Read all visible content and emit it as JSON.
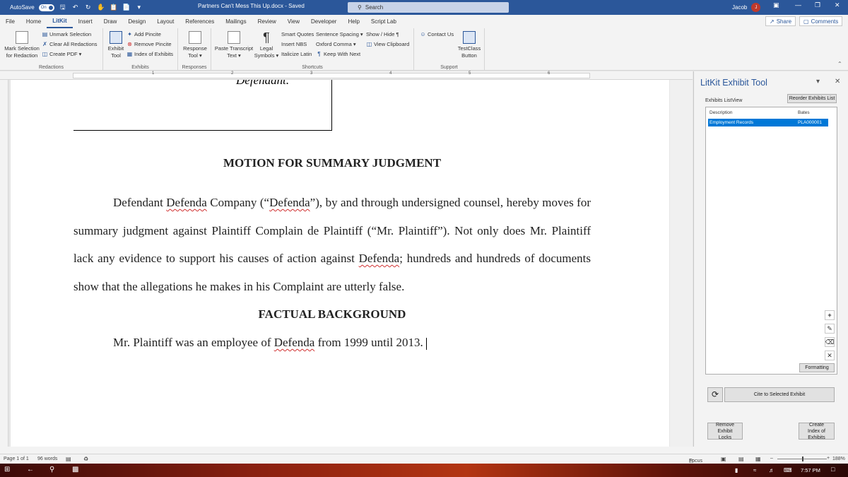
{
  "titlebar": {
    "autosave_label": "AutoSave",
    "autosave_state": "On",
    "doc_title": "Partners Can't Mess This Up.docx  -  Saved",
    "search_placeholder": "Search",
    "user_name": "Jacob",
    "user_initials": "J"
  },
  "menu": {
    "tabs": [
      "File",
      "Home",
      "LitKit",
      "Insert",
      "Draw",
      "Design",
      "Layout",
      "References",
      "Mailings",
      "Review",
      "View",
      "Developer",
      "Help",
      "Script Lab"
    ],
    "share": "Share",
    "comments": "Comments"
  },
  "ribbon": {
    "redactions": {
      "label": "Redactions",
      "mark_selection": "Mark Selection",
      "for_redaction": "for Redaction",
      "unmark_selection": "Unmark Selection",
      "clear_all": "Clear All Redactions",
      "create_pdf": "Create PDF"
    },
    "exhibits": {
      "label": "Exhibits",
      "exhibit": "Exhibit",
      "tool": "Tool",
      "add_pincite": "Add Pincite",
      "remove_pincite": "Remove Pincite",
      "index_of_exhibits": "Index of Exhibits"
    },
    "responses": {
      "label": "Responses",
      "response": "Response",
      "tool": "Tool"
    },
    "shortcuts": {
      "label": "Shortcuts",
      "paste_transcript": "Paste Transcript",
      "text": "Text",
      "legal": "Legal",
      "symbols": "Symbols",
      "smart_quotes": "Smart Quotes",
      "insert_nbs": "Insert NBS",
      "italicize_latin": "Italicize Latin",
      "sentence_spacing": "Sentence Spacing",
      "oxford_comma": "Oxford Comma",
      "keep_with_next": "Keep With Next",
      "show_hide": "Show / Hide ¶",
      "view_clipboard": "View Clipboard"
    },
    "support": {
      "label": "Support",
      "contact_us": "Contact Us",
      "testclass": "TestClass",
      "button": "Button"
    }
  },
  "document": {
    "caption_party": "Defendant.",
    "heading1": "MOTION FOR SUMMARY JUDGMENT",
    "p1_a": "Defendant ",
    "p1_defenda1": "Defenda",
    "p1_b": " Company (“",
    "p1_defenda2": "Defenda",
    "p1_c": "”), by and through undersigned counsel, hereby moves for summary judgment against Plaintiff Complain de Plaintiff (“Mr. Plaintiff”).  Not only does Mr. Plaintiff lack any evidence to support his causes of action against ",
    "p1_defenda3": "Defenda",
    "p1_d": "; hundreds and hundreds of documents show that the allegations he makes in his Complaint are utterly false.",
    "heading2": "FACTUAL BACKGROUND",
    "p2_a": "Mr. Plaintiff was an employee of ",
    "p2_defenda": "Defenda",
    "p2_b": " from 1999 until 2013."
  },
  "pane": {
    "title": "LitKit Exhibit Tool",
    "listview_label": "Exhibits ListView",
    "reorder": "Reorder Exhibits List",
    "col_description": "Description",
    "col_bates": "Bates",
    "rows": [
      {
        "description": "Employment Records",
        "bates": "PLA000001"
      }
    ],
    "formatting": "Formatting",
    "cite": "Cite to Selected Exhibit",
    "remove_locks": "Remove Exhibit Locks",
    "create_index": "Create Index of Exhibits"
  },
  "status": {
    "page": "Page 1 of 1",
    "words": "96 words",
    "focus": "Focus",
    "zoom": "188%"
  },
  "taskbar": {
    "time": "7:57 PM"
  }
}
